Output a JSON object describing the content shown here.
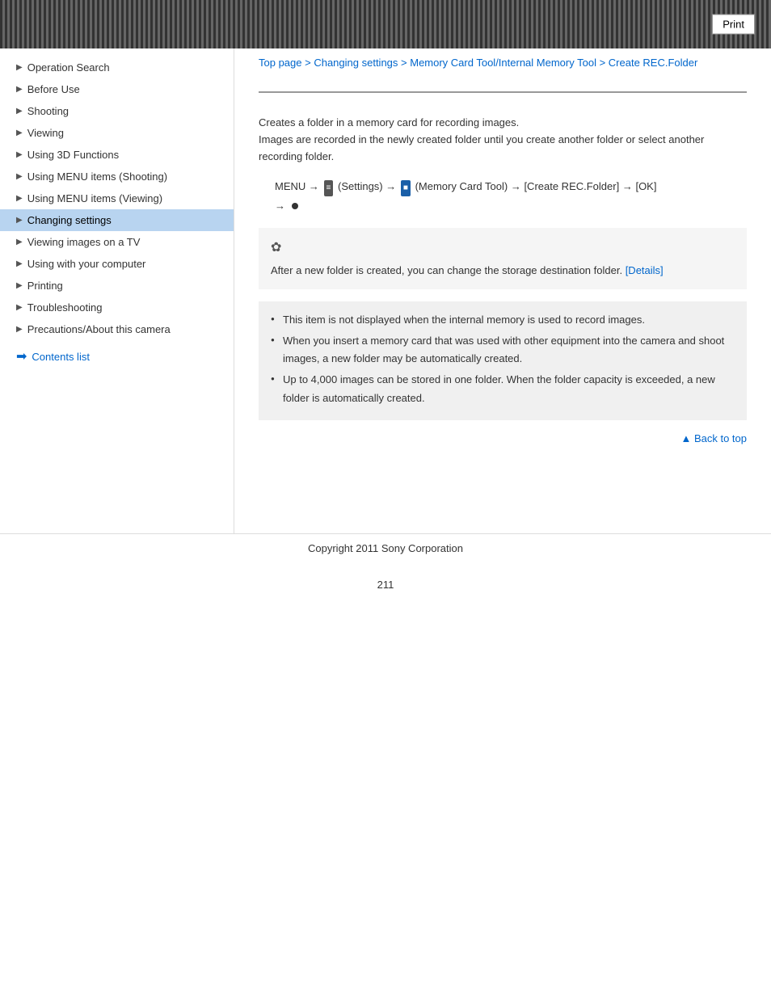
{
  "header": {
    "print_label": "Print"
  },
  "breadcrumb": {
    "items": [
      {
        "label": "Top page",
        "href": "#"
      },
      {
        "label": "Changing settings",
        "href": "#"
      },
      {
        "label": "Memory Card Tool/Internal Memory Tool",
        "href": "#"
      },
      {
        "label": "Create REC.Folder",
        "href": "#"
      }
    ],
    "separator": " > "
  },
  "sidebar": {
    "items": [
      {
        "label": "Operation Search",
        "active": false
      },
      {
        "label": "Before Use",
        "active": false
      },
      {
        "label": "Shooting",
        "active": false
      },
      {
        "label": "Viewing",
        "active": false
      },
      {
        "label": "Using 3D Functions",
        "active": false
      },
      {
        "label": "Using MENU items (Shooting)",
        "active": false
      },
      {
        "label": "Using MENU items (Viewing)",
        "active": false
      },
      {
        "label": "Changing settings",
        "active": true
      },
      {
        "label": "Viewing images on a TV",
        "active": false
      },
      {
        "label": "Using with your computer",
        "active": false
      },
      {
        "label": "Printing",
        "active": false
      },
      {
        "label": "Troubleshooting",
        "active": false
      },
      {
        "label": "Precautions/About this camera",
        "active": false
      }
    ],
    "contents_list_label": "Contents list"
  },
  "main": {
    "description_line1": "Creates a folder in a memory card for recording images.",
    "description_line2": "Images are recorded in the newly created folder until you create another folder or select another recording folder.",
    "menu_path": "MENU → ≡ (Settings) → ■ (Memory Card Tool) → [Create REC.Folder] → [OK] → ●",
    "menu_path_parts": {
      "menu": "MENU",
      "arrow1": "→",
      "settings_icon": "≡",
      "settings_label": "(Settings)",
      "arrow2": "→",
      "memory_icon": "■",
      "memory_label": "(Memory Card Tool)",
      "arrow3": "→",
      "create_label": "[Create REC.Folder]",
      "arrow4": "→",
      "ok_label": "[OK]",
      "arrow5": "→",
      "bullet": "●"
    },
    "tip": {
      "icon": "✿",
      "text": "After a new folder is created, you can change the storage destination folder.",
      "details_label": "[Details]"
    },
    "notes": {
      "items": [
        "This item is not displayed when the internal memory is used to record images.",
        "When you insert a memory card that was used with other equipment into the camera and shoot images, a new folder may be automatically created.",
        "Up to 4,000 images can be stored in one folder. When the folder capacity is exceeded, a new folder is automatically created."
      ]
    },
    "back_to_top_label": "▲ Back to top",
    "copyright": "Copyright 2011 Sony Corporation",
    "page_number": "211"
  }
}
